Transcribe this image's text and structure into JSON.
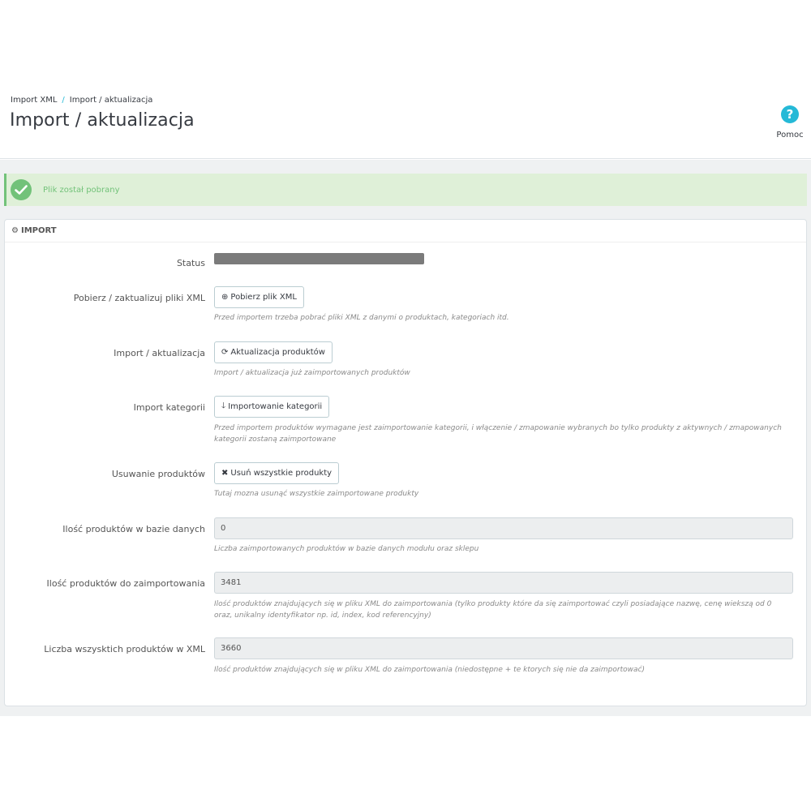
{
  "header": {
    "breadcrumb": [
      "Import XML",
      "Import / aktualizacja"
    ],
    "breadcrumb_separator": "/",
    "title": "Import / aktualizacja",
    "help": {
      "icon": "question-circle-icon",
      "label": "Pomoc"
    }
  },
  "alert": {
    "icon": "check-circle-icon",
    "text": "Plik został pobrany",
    "color": "#72c279"
  },
  "panel": {
    "heading_icon": "cogs-icon",
    "heading": "IMPORT",
    "rows": {
      "status": {
        "label": "Status"
      },
      "download": {
        "label": "Pobierz / zaktualizuj pliki XML",
        "button": "Pobierz plik XML",
        "button_icon": "download-circle-icon",
        "help": "Przed importem trzeba pobrać pliki XML z danymi o produktach, kategoriach itd."
      },
      "update": {
        "label": "Import / aktualizacja",
        "button": "Aktualizacja produktów",
        "button_icon": "refresh-icon",
        "help": "Import / aktualizacja już zaimportowanych produktów"
      },
      "categories": {
        "label": "Import kategorii",
        "button": "Importowanie kategorii",
        "button_icon": "arrow-down-icon",
        "help": "Przed importem produktów wymagane jest zaimportowanie kategorii, i włączenie / zmapowanie wybranych bo tylko produkty z aktywnych / zmapowanych kategorii zostaną zaimportowane"
      },
      "delete": {
        "label": "Usuwanie produktów",
        "button": "Usuń wszystkie produkty",
        "button_icon": "times-icon",
        "help": "Tutaj mozna usunąć wszystkie zaimportowane produkty"
      },
      "db_count": {
        "label": "Ilość produktów w bazie danych",
        "value": "0",
        "help": "Liczba zaimportowanych produktów w bazie danych modułu oraz sklepu"
      },
      "to_import": {
        "label": "Ilość produktów do zaimportowania",
        "value": "3481",
        "help": "Ilość produktów znajdujących się w pliku XML do zaimportowania (tylko produkty które da się zaimportować czyli posiadające nazwę, cenę wiekszą od 0 oraz, unikalny identyfikator np. id, index, kod referencyjny)"
      },
      "xml_total": {
        "label": "Liczba wszysktich produktów w XML",
        "value": "3660",
        "help": "Ilość produktów znajdujących się w pliku XML do zaimportowania (niedostępne + te ktorych się nie da zaimportować)"
      }
    }
  },
  "colors": {
    "accent": "#25b9d7",
    "success": "#72c279",
    "page_bg": "#eff1f2"
  }
}
